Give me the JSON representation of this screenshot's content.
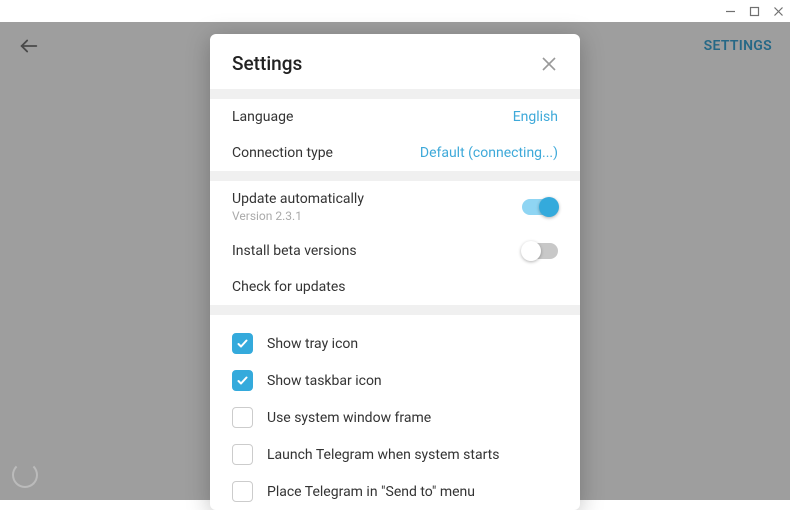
{
  "window": {
    "min_icon": "−",
    "max_icon": "□",
    "close_icon": "×"
  },
  "header": {
    "settings_link": "SETTINGS"
  },
  "modal": {
    "title": "Settings",
    "language": {
      "label": "Language",
      "value": "English"
    },
    "connection": {
      "label": "Connection type",
      "value": "Default (connecting...)"
    },
    "update": {
      "label": "Update automatically",
      "version": "Version 2.3.1",
      "on": true
    },
    "beta": {
      "label": "Install beta versions",
      "on": false
    },
    "check_updates": {
      "label": "Check for updates"
    },
    "checks": [
      {
        "label": "Show tray icon",
        "checked": true
      },
      {
        "label": "Show taskbar icon",
        "checked": true
      },
      {
        "label": "Use system window frame",
        "checked": false
      },
      {
        "label": "Launch Telegram when system starts",
        "checked": false
      },
      {
        "label": "Place Telegram in \"Send to\" menu",
        "checked": false
      }
    ]
  }
}
